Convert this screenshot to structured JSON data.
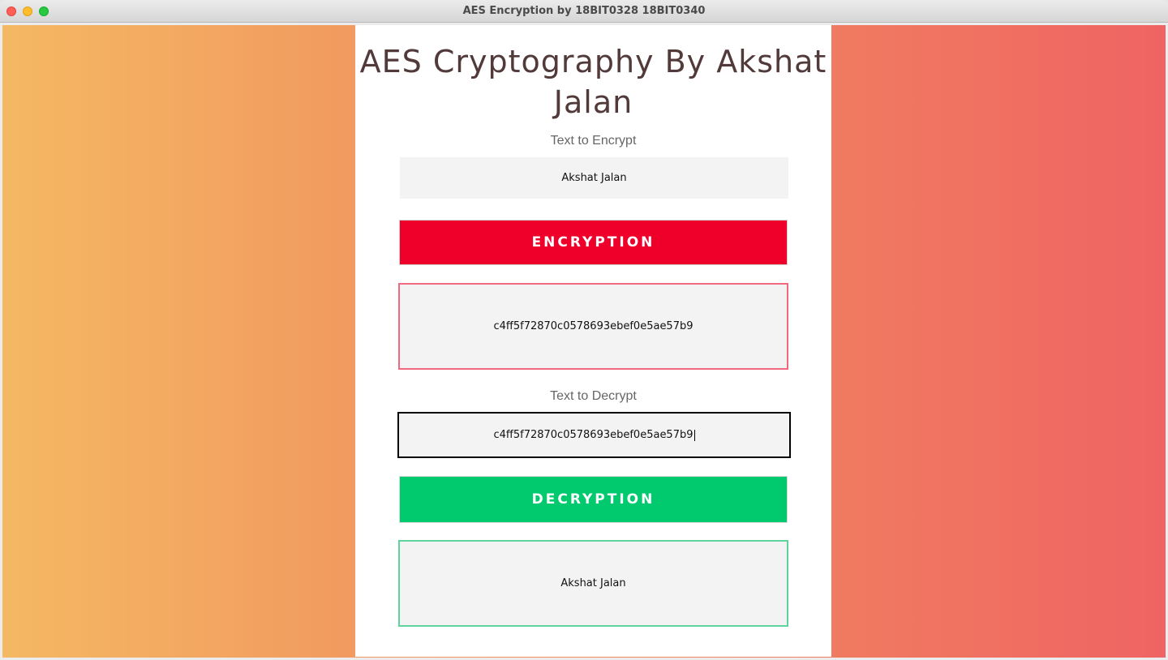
{
  "window": {
    "title": "AES Encryption by 18BIT0328 18BIT0340"
  },
  "page": {
    "heading": "AES Cryptography By Akshat Jalan"
  },
  "encrypt": {
    "label": "Text to Encrypt",
    "input_value": "Akshat Jalan",
    "button_label": "ENCRYPTION",
    "button_color": "#ee002a",
    "output_value": "c4ff5f72870c0578693ebef0e5ae57b9",
    "output_border": "#f0697f"
  },
  "decrypt": {
    "label": "Text to Decrypt",
    "input_value": "c4ff5f72870c0578693ebef0e5ae57b9",
    "button_label": "DECRYPTION",
    "button_color": "#00c96e",
    "output_value": "Akshat Jalan",
    "output_border": "#5fd39b"
  }
}
